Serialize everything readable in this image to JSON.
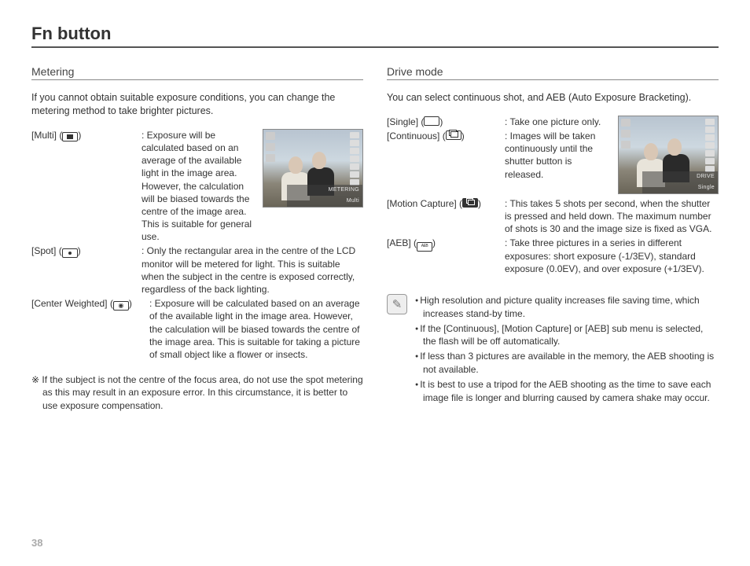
{
  "pageTitle": "Fn button",
  "pageNumber": "38",
  "left": {
    "heading": "Metering",
    "intro": "If you cannot obtain suitable exposure conditions, you can change the metering method to take brighter pictures.",
    "items": [
      {
        "label": "[Multi] (",
        "labelSuffix": ")",
        "desc": ": Exposure will be calculated based on an average of the available light in the image area. However, the calculation will be biased towards the centre of the image area. This is suitable for general use."
      },
      {
        "label": "[Spot] (",
        "labelSuffix": ")",
        "desc": ": Only the rectangular area in the centre of the LCD monitor will be metered for light. This is suitable when the subject in the centre is exposed correctly, regardless of the back lighting."
      },
      {
        "label": "[Center Weighted] (",
        "labelSuffix": ")",
        "desc": ": Exposure will be calculated based on an average of the available light in the image area. However, the calculation will be biased towards the centre of the image area. This is suitable for taking a picture of small object like a flower or insects."
      }
    ],
    "note": "If the subject is not the centre of the focus area, do not use the spot metering as this may result in an exposure error. In this circumstance, it is better to use exposure compensation.",
    "thumb": {
      "banner1": "METERING",
      "banner2": "Multi"
    }
  },
  "right": {
    "heading": "Drive mode",
    "intro": "You can select continuous shot, and AEB (Auto Exposure Bracketing).",
    "items": [
      {
        "label": "[Single] (",
        "labelSuffix": ")",
        "desc": ": Take one picture only."
      },
      {
        "label": "[Continuous] (",
        "labelSuffix": ")",
        "desc": ": Images will be taken continuously until the shutter button is released."
      },
      {
        "label": "[Motion Capture] (",
        "labelSuffix": ")",
        "desc": ": This takes 5 shots per second, when the shutter is pressed and held down. The maximum number of shots is 30 and the image size is fixed as VGA."
      },
      {
        "label": "[AEB] (",
        "labelSuffix": ")",
        "desc": ": Take three pictures in a series in different exposures: short exposure (-1/3EV), standard exposure (0.0EV), and over exposure (+1/3EV)."
      }
    ],
    "info": [
      "High resolution and picture quality increases file saving time, which increases stand-by time.",
      "If the [Continuous], [Motion Capture] or [AEB] sub menu is selected, the flash will be off automatically.",
      "If less than 3 pictures are available in the memory, the AEB shooting is not available.",
      "It is best to use a tripod for the AEB shooting as the time to save each image file is longer and blurring caused by camera shake may occur."
    ],
    "thumb": {
      "banner1": "DRIVE",
      "banner2": "Single"
    }
  }
}
